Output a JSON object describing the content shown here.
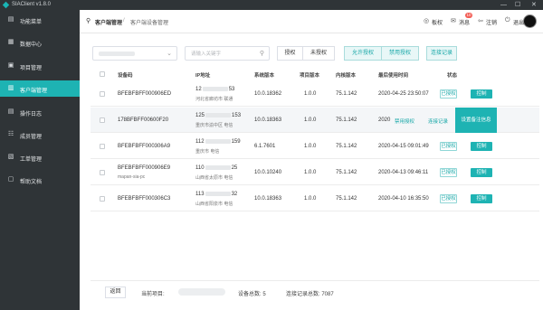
{
  "app": {
    "title": "SIAClient v1.8.0",
    "window_controls": [
      "—",
      "☐",
      "✕"
    ]
  },
  "sidebar": {
    "items": [
      {
        "icon": "menu-icon",
        "glyph": "▤",
        "label": "功能菜单",
        "active": false
      },
      {
        "icon": "dashboard-icon",
        "glyph": "▦",
        "label": "数据中心",
        "active": false
      },
      {
        "icon": "project-icon",
        "glyph": "▣",
        "label": "项目管理",
        "active": false
      },
      {
        "icon": "client-icon",
        "glyph": "▥",
        "label": "客户端管理",
        "active": true
      },
      {
        "icon": "log-icon",
        "glyph": "▤",
        "label": "操作日志",
        "active": false
      },
      {
        "icon": "member-icon",
        "glyph": "☷",
        "label": "成员管理",
        "active": false
      },
      {
        "icon": "ticket-icon",
        "glyph": "▧",
        "label": "工单管理",
        "active": false
      },
      {
        "icon": "help-icon",
        "glyph": "▢",
        "label": "帮助文档",
        "active": false
      }
    ]
  },
  "header": {
    "breadcrumb": [
      "客户端管理",
      "客户端设备管理"
    ],
    "separator": "/",
    "actions": [
      {
        "icon": "board-icon",
        "glyph": "◎",
        "label": "板权"
      },
      {
        "icon": "message-icon",
        "glyph": "✉",
        "label": "消息",
        "badge": "10"
      },
      {
        "icon": "logout-icon",
        "glyph": "⇦",
        "label": "注销"
      },
      {
        "icon": "exit-icon",
        "glyph": "⏻",
        "label": "退出"
      }
    ]
  },
  "toolbar": {
    "search_placeholder": "请输入关键字",
    "filter_buttons": [
      "授权",
      "未授权"
    ],
    "action_buttons": [
      "允许授权",
      "禁用授权"
    ],
    "record_button": "连接记录"
  },
  "table": {
    "columns": [
      "设备码",
      "IP地址",
      "系统版本",
      "项目版本",
      "内核版本",
      "最后使用时间",
      "状态"
    ],
    "rows": [
      {
        "device": "BFEBFBFF000906ED",
        "device_sub": "",
        "ip_prefix": "12",
        "ip_suffix": "53",
        "location": "河北省廊坊市 联通",
        "os": "10.0.18362",
        "project": "1.0.0",
        "kernel": "75.1.142",
        "time": "2020-04-25 23:50:07",
        "status": "已授权",
        "control": "控制"
      },
      {
        "device": "178BFBFF00600F20",
        "device_sub": "",
        "ip_prefix": "125",
        "ip_suffix": "153",
        "location": "重庆市渝中区 电信",
        "os": "10.0.18363",
        "project": "1.0.0",
        "kernel": "75.1.142",
        "time": "2020",
        "status": "",
        "control": ""
      },
      {
        "device": "BFEBFBFF000306A9",
        "device_sub": "",
        "ip_prefix": "112",
        "ip_suffix": "159",
        "location": "重庆市 电信",
        "os": "6.1.7601",
        "project": "1.0.0",
        "kernel": "75.1.142",
        "time": "2020-04-15 09:01:49",
        "status": "已授权",
        "control": "控制"
      },
      {
        "device": "BFEBFBFF000906E9",
        "device_sub": "mapan-sia-pc",
        "ip_prefix": "110",
        "ip_suffix": "25",
        "location": "山西省太原市 电信",
        "os": "10.0.10240",
        "project": "1.0.0",
        "kernel": "75.1.142",
        "time": "2020-04-13 09:46:11",
        "status": "已授权",
        "control": "控制"
      },
      {
        "device": "BFEBFBFF000306C3",
        "device_sub": "",
        "ip_prefix": "113",
        "ip_suffix": "32",
        "location": "山西省阳泉市 电信",
        "os": "10.0.18363",
        "project": "1.0.0",
        "kernel": "75.1.142",
        "time": "2020-04-10 16:35:50",
        "status": "已授权",
        "control": "控制"
      }
    ],
    "hover_row": {
      "disable_link": "禁用授权",
      "record_link": "连接记录",
      "remark_button": "设置备注信息"
    }
  },
  "footer": {
    "back_button": "返回",
    "project_label": "当前项目:",
    "device_count": "设备总数: 5",
    "connection_count": "连接记录总数: 7087"
  }
}
